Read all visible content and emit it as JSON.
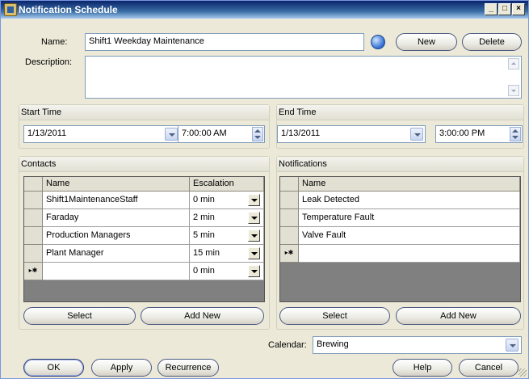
{
  "window": {
    "title": "Notification Schedule",
    "icon": "schedule-app-icon",
    "min_glyph": "_",
    "max_glyph": "□",
    "close_glyph": "×"
  },
  "name": {
    "label": "Name:",
    "value": "Shift1 Weekday Maintenance"
  },
  "description": {
    "label": "Description:",
    "value": ""
  },
  "top_buttons": {
    "new": "New",
    "delete": "Delete"
  },
  "start_time": {
    "header": "Start Time",
    "date": "1/13/2011",
    "time": "7:00:00 AM"
  },
  "end_time": {
    "header": "End Time",
    "date": "1/13/2011",
    "time": "3:00:00 PM"
  },
  "contacts": {
    "header": "Contacts",
    "columns": [
      "Name",
      "Escalation"
    ],
    "rows": [
      {
        "name": "Shift1MaintenanceStaff",
        "escalation": "0 min"
      },
      {
        "name": "Faraday",
        "escalation": "2 min"
      },
      {
        "name": "Production Managers",
        "escalation": "5 min"
      },
      {
        "name": "Plant Manager",
        "escalation": "15 min"
      },
      {
        "name": "",
        "escalation": "0 min",
        "new_row": true
      }
    ],
    "new_row_marker": "▸✱",
    "select": "Select",
    "add_new": "Add New"
  },
  "notifications": {
    "header": "Notifications",
    "columns": [
      "Name"
    ],
    "rows": [
      {
        "name": "Leak Detected"
      },
      {
        "name": "Temperature Fault"
      },
      {
        "name": "Valve Fault"
      },
      {
        "name": "",
        "new_row": true
      }
    ],
    "new_row_marker": "▸✱",
    "select": "Select",
    "add_new": "Add New"
  },
  "calendar": {
    "label": "Calendar:",
    "value": "Brewing"
  },
  "bottom_buttons": {
    "ok": "OK",
    "apply": "Apply",
    "recurrence": "Recurrence",
    "help": "Help",
    "cancel": "Cancel"
  },
  "colors": {
    "title_bar": "#0a246a",
    "window_bg": "#ece9d8",
    "grid_bg": "#808080",
    "field_border": "#7f9db9"
  }
}
